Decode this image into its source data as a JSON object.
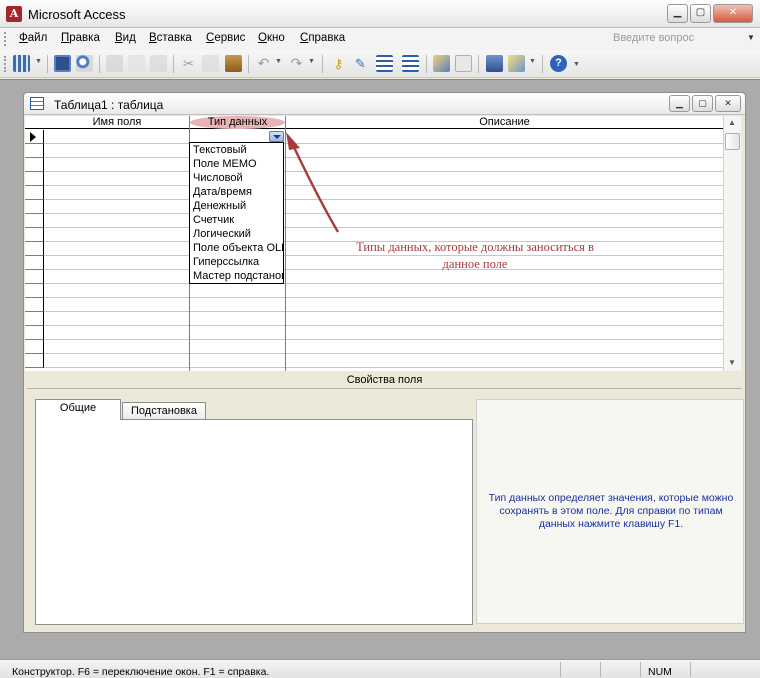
{
  "app": {
    "title": "Microsoft Access",
    "icon": "access-app-icon"
  },
  "menu": {
    "items": [
      "Файл",
      "Правка",
      "Вид",
      "Вставка",
      "Сервис",
      "Окно",
      "Справка"
    ],
    "help_placeholder": "Введите вопрос"
  },
  "toolbar": {
    "icons": [
      "view-icon",
      "save-icon",
      "search-icon",
      "print-icon",
      "print-preview-icon",
      "spelling-icon",
      "cut-icon",
      "copy-icon",
      "paste-icon",
      "undo-icon",
      "redo-icon",
      "primary-key-icon",
      "builder-icon",
      "insert-rows-icon",
      "delete-rows-icon",
      "properties-icon",
      "indexes-icon",
      "database-window-icon",
      "new-object-icon",
      "help-icon"
    ]
  },
  "table_window": {
    "title": "Таблица1 : таблица",
    "columns": {
      "field_name": "Имя поля",
      "data_type": "Тип данных",
      "description": "Описание"
    },
    "data_type_options": [
      "Текстовый",
      "Поле MEMO",
      "Числовой",
      "Дата/время",
      "Денежный",
      "Счетчик",
      "Логический",
      "Поле объекта OLE",
      "Гиперссылка",
      "Мастер подстановок..."
    ],
    "field_properties_label": "Свойства поля",
    "tabs": [
      "Общие",
      "Подстановка"
    ],
    "hint": "Тип данных определяет значения, которые можно сохранять в этом поле.  Для справки по типам данных нажмите клавишу F1."
  },
  "annotation": {
    "text_line1": "Типы данных, которые должны заноситься в",
    "text_line2": "данное  поле",
    "color": "#a83a3a"
  },
  "status": {
    "text": "Конструктор.  F6 = переключение окон.  F1 = справка.",
    "num": "NUM"
  }
}
